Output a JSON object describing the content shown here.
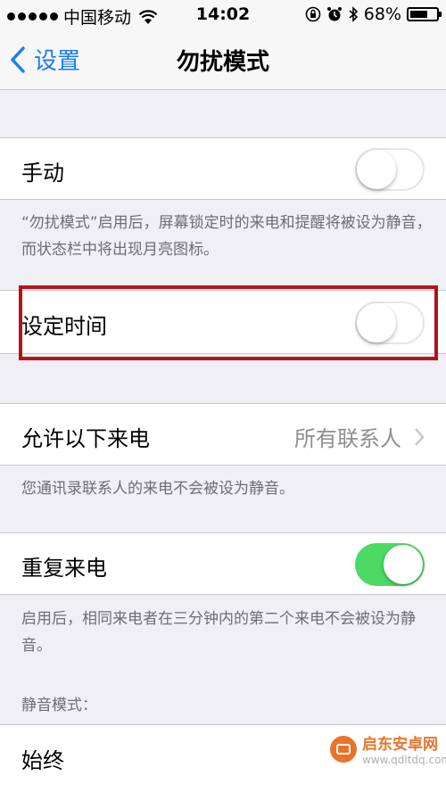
{
  "status_bar": {
    "carrier": "中国移动",
    "time": "14:02",
    "battery": "68%",
    "battery_level": 0.68
  },
  "nav": {
    "back_label": "设置",
    "title": "勿扰模式"
  },
  "manual": {
    "label": "手动",
    "on": false,
    "footer": "“勿扰模式”启用后，屏幕锁定时的来电和提醒将被设为静音，而状态栏中将出现月亮图标。"
  },
  "scheduled": {
    "label": "设定时间",
    "on": false
  },
  "allow_calls": {
    "label": "允许以下来电",
    "value": "所有联系人",
    "footer": "您通讯录联系人的来电不会被设为静音。"
  },
  "repeated_calls": {
    "label": "重复来电",
    "on": true,
    "footer": "启用后，相同来电者在三分钟内的第二个来电不会被设为静音。"
  },
  "silence": {
    "header": "静音模式：",
    "option": "始终"
  },
  "watermark": {
    "brand": "启东安卓网",
    "url": "www.qdltdq.com"
  },
  "colors": {
    "accent": "#1a7cf7",
    "toggle_on": "#4cd964",
    "highlight": "#b5121b"
  }
}
